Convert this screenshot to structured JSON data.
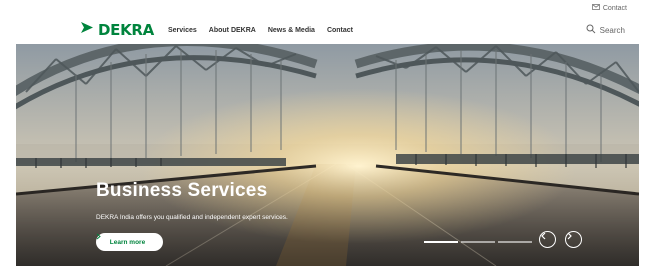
{
  "topbar": {
    "contact_label": "Contact"
  },
  "brand": {
    "name": "DEKRA",
    "color": "#00843d"
  },
  "nav": {
    "items": [
      "Services",
      "About DEKRA",
      "News & Media",
      "Contact"
    ]
  },
  "search": {
    "label": "Search"
  },
  "hero": {
    "title": "Business Services",
    "subtitle": "DEKRA India offers you qualified and independent expert services.",
    "cta_label": "Learn more",
    "slides": [
      {
        "active": true
      },
      {
        "active": false
      },
      {
        "active": false
      }
    ]
  },
  "icons": {
    "contact": "mail-icon",
    "search": "search-icon",
    "cta": "chevron-right-icon",
    "prev": "arrow-left-circle-icon",
    "next": "arrow-right-circle-icon"
  }
}
